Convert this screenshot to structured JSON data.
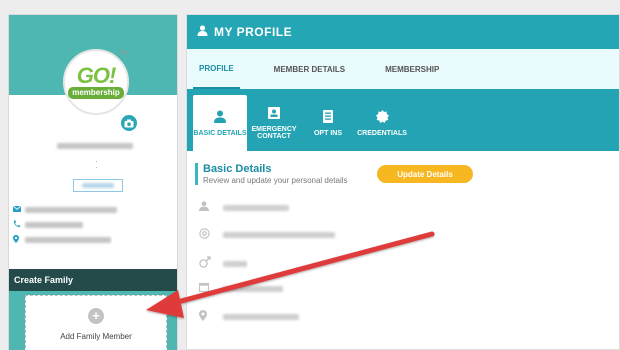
{
  "profile_card": {
    "logo_text": "GO!",
    "logo_sub": "membership",
    "tm": "TM",
    "camera_icon": "camera-icon",
    "contact_icons": [
      "envelope-icon",
      "phone-icon",
      "location-pin-icon"
    ]
  },
  "create_family": {
    "title": "Create Family",
    "add_member_label": "Add Family Member",
    "plus": "+"
  },
  "header": {
    "title": "MY PROFILE",
    "icon": "user-icon"
  },
  "tabs": [
    {
      "label": "PROFILE",
      "active": true
    },
    {
      "label": "MEMBER DETAILS",
      "active": false
    },
    {
      "label": "MEMBERSHIP",
      "active": false
    }
  ],
  "subtabs": [
    {
      "label": "BASIC DETAILS",
      "icon": "user-badge-icon",
      "active": true
    },
    {
      "label": "EMERGENCY CONTACT",
      "icon": "contact-card-icon",
      "active": false
    },
    {
      "label": "OPT INS",
      "icon": "document-list-icon",
      "active": false
    },
    {
      "label": "CREDENTIALS",
      "icon": "gear-badge-icon",
      "active": false
    }
  ],
  "basic_details": {
    "title": "Basic Details",
    "subtitle": "Review and update your personal details",
    "update_button": "Update Details",
    "field_icons": [
      "user-icon",
      "at-icon",
      "gender-icon",
      "calendar-icon",
      "location-pin-icon"
    ]
  },
  "colors": {
    "teal": "#25a6b5",
    "dark_teal": "#244a4a",
    "accent_yellow": "#f6b721",
    "arrow_red": "#e03b3b"
  }
}
